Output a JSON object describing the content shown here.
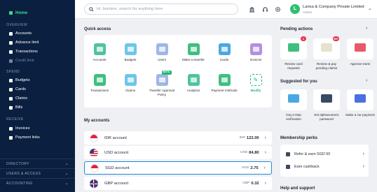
{
  "sidebar": {
    "home": "Home",
    "sections": [
      {
        "title": "OVERVIEW",
        "items": [
          {
            "label": "Accounts",
            "dim": false
          },
          {
            "label": "Advance limit",
            "dim": false
          },
          {
            "label": "Transactions",
            "dim": false
          },
          {
            "label": "Credit limit",
            "dim": true
          }
        ]
      },
      {
        "title": "SPEND",
        "items": [
          {
            "label": "Budgets"
          },
          {
            "label": "Cards"
          },
          {
            "label": "Claims"
          },
          {
            "label": "Bills"
          }
        ]
      },
      {
        "title": "RECEIVE",
        "items": [
          {
            "label": "Invoices"
          },
          {
            "label": "Payment links"
          }
        ]
      }
    ],
    "bottom": [
      "DIRECTORY",
      "USERS & ACCESS",
      "ACCOUNTING"
    ]
  },
  "topbar": {
    "search_placeholder": "Hi Jasmine, search for anything here",
    "avatar_initial": "L",
    "user_name": "Larisa & Company Private Limited",
    "user_role": "Admin",
    "icons": [
      "bank-icon",
      "headset-icon",
      "gear-icon"
    ]
  },
  "quick_access": {
    "title": "Quick access",
    "items": [
      {
        "label": "Accounts",
        "color": "#4fc3a1"
      },
      {
        "label": "Budgets",
        "color": "#6ec6e8"
      },
      {
        "label": "Users",
        "color": "#9fb7e6"
      },
      {
        "label": "Make a transfer",
        "color": "#3fbf7f"
      },
      {
        "label": "Cards",
        "color": "#4aa8e0"
      },
      {
        "label": "Invoices",
        "color": "#b58fe0"
      },
      {
        "label": "Transactions",
        "color": "#3fbf7f"
      },
      {
        "label": "Claims",
        "color": "#6ec6e8"
      },
      {
        "label": "Transfer Approval Policy",
        "color": "#9fb7e6",
        "badge": "BETA"
      },
      {
        "label": "Analytics",
        "color": "#4fc3a1"
      },
      {
        "label": "Payment methods",
        "color": "#3fbf7f"
      }
    ],
    "modify_label": "Modify"
  },
  "accounts": {
    "title": "My accounts",
    "rows": [
      {
        "name": "IDR account",
        "currency": "IDR",
        "amount": "122.00"
      },
      {
        "name": "USD account",
        "currency": "USD",
        "amount": "84.80"
      },
      {
        "name": "SGD account",
        "currency": "SGD",
        "amount": "2.75"
      },
      {
        "name": "GBP account",
        "currency": "GBP",
        "amount": "0.32"
      }
    ],
    "selected": "SGD account"
  },
  "pending_actions": {
    "title": "Pending actions",
    "items": [
      {
        "label": "Review card requests",
        "badge": "1",
        "color": "#3fbf7f"
      },
      {
        "label": "Review & pay pending claims",
        "badge": "99+",
        "color": "#e8e1d0"
      },
      {
        "label": "Approve trans",
        "badge": "",
        "color": "#e85a6a"
      }
    ]
  },
  "suggested": {
    "title": "Suggested for you",
    "items": [
      {
        "label": "Org 2-step verification",
        "color": "#4aa8e0"
      },
      {
        "label": "Set alphanumeric password",
        "color": "#3b4a63"
      },
      {
        "label": "Make a car payment",
        "color": "#4a6fe0"
      }
    ]
  },
  "membership": {
    "title": "Membership perks",
    "items": [
      "Refer & earn SGD 50",
      "Earn cashback"
    ]
  },
  "help": {
    "title": "Help and support"
  }
}
